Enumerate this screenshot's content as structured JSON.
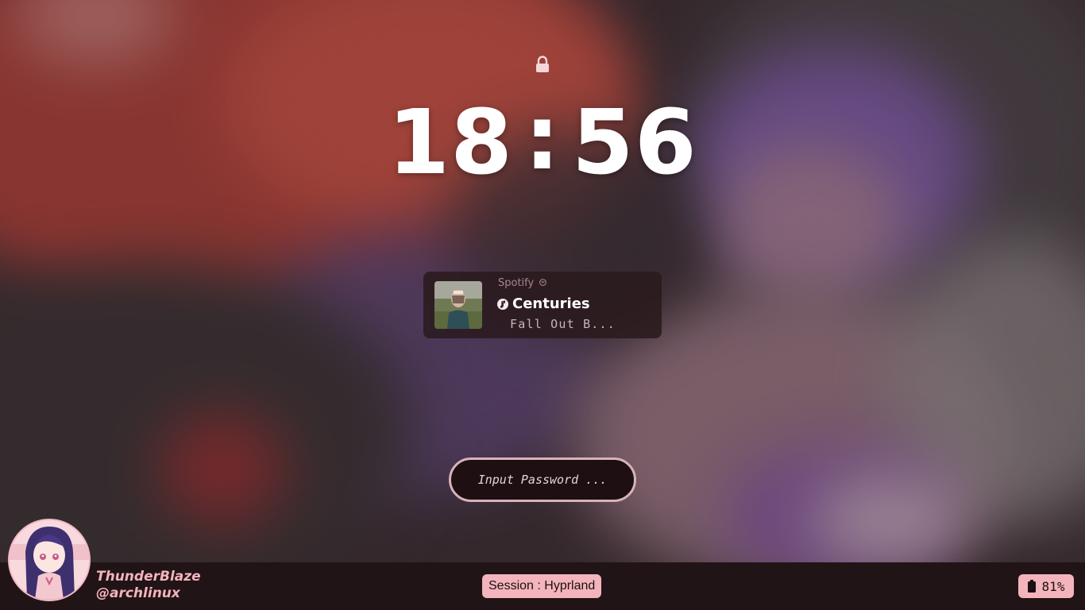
{
  "clock": {
    "hour": "18",
    "separator": ":",
    "minute": "56"
  },
  "media": {
    "player": "Spotify",
    "player_icon": "spotify-icon",
    "title_icon": "music-note-icon",
    "title": "Centuries",
    "artist": "Fall Out B..."
  },
  "password": {
    "placeholder": "Input Password ..."
  },
  "user": {
    "name": "ThunderBlaze",
    "host": "@archlinux"
  },
  "session": {
    "label": "Session : Hyprland"
  },
  "battery": {
    "percent": "81%",
    "icon": "battery-icon"
  },
  "colors": {
    "accent": "#f4b4bd",
    "bar": "#211416",
    "card": "#2a1a1e",
    "input_border": "#d7b3b9"
  }
}
